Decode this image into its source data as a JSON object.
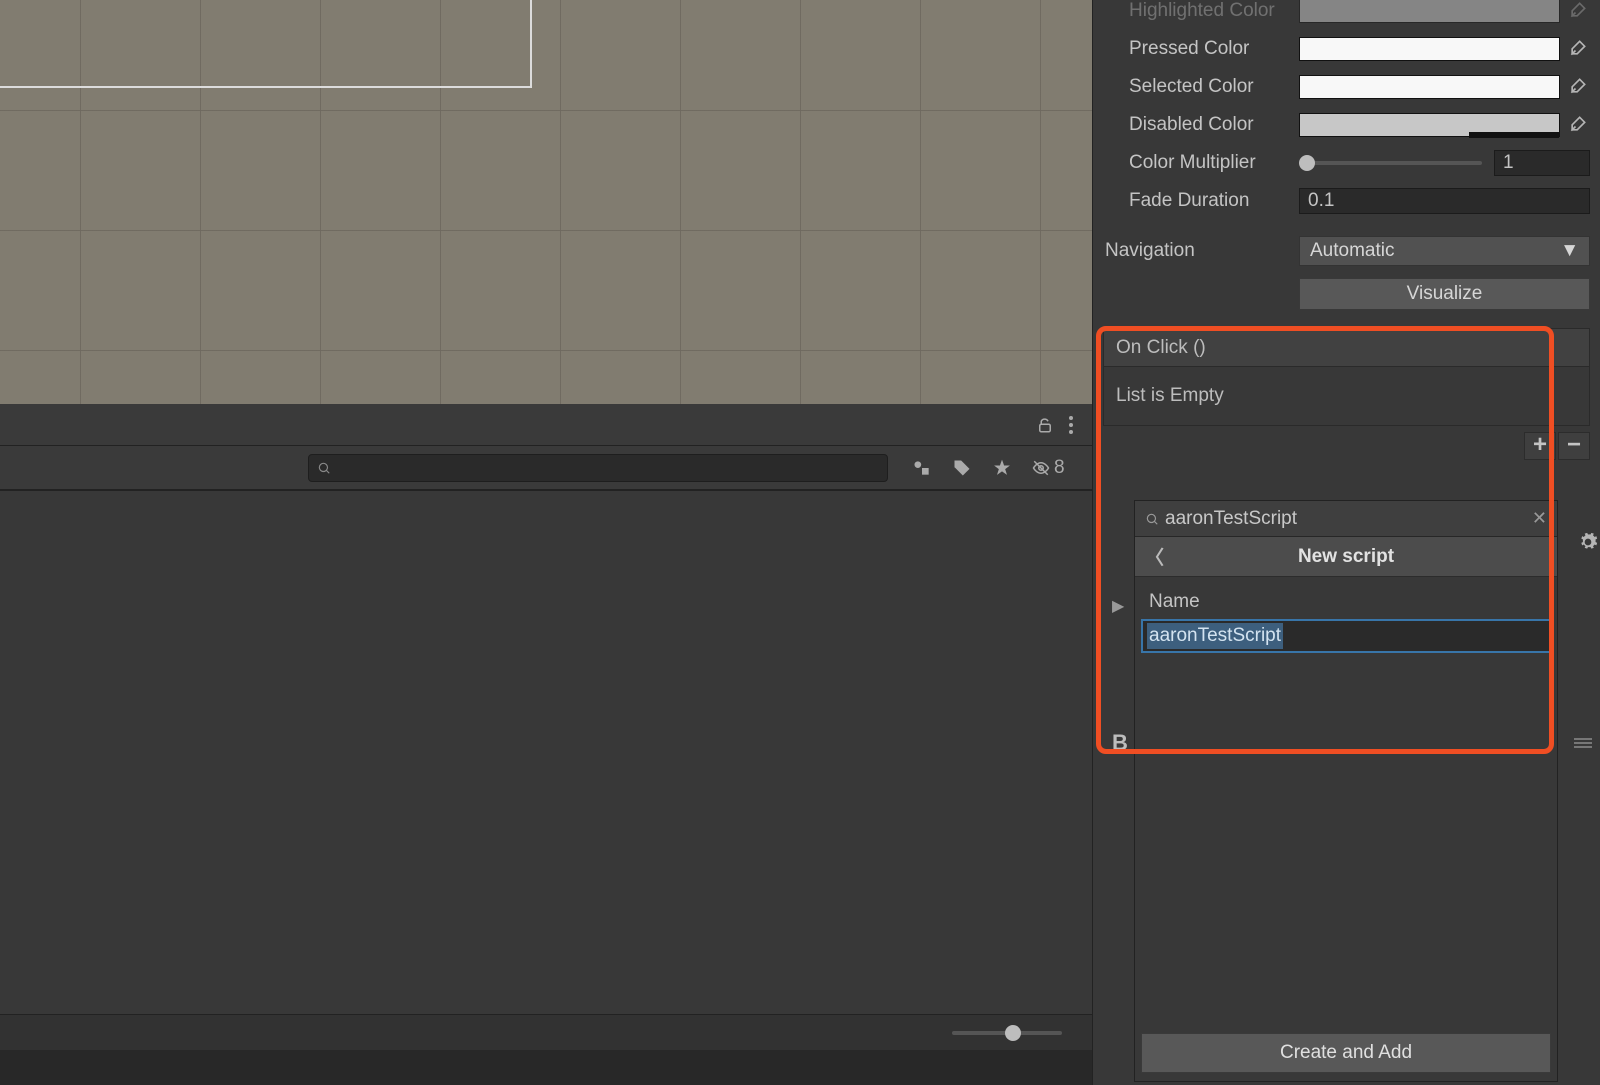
{
  "inspector": {
    "highlighted_label": "Highlighted Color",
    "pressed_label": "Pressed Color",
    "selected_label": "Selected Color",
    "disabled_label": "Disabled Color",
    "multiplier_label": "Color Multiplier",
    "multiplier_value": "1",
    "fade_label": "Fade Duration",
    "fade_value": "0.1",
    "navigation_label": "Navigation",
    "navigation_value": "Automatic",
    "visualize_label": "Visualize",
    "onclick_header": "On Click ()",
    "onclick_empty": "List is Empty"
  },
  "popup": {
    "search_value": "aaronTestScript",
    "title": "New script",
    "name_label": "Name",
    "name_value": "aaronTestScript",
    "create_label": "Create and Add"
  },
  "bottom": {
    "hidden_count": "8"
  },
  "stray": {
    "b": "B"
  }
}
